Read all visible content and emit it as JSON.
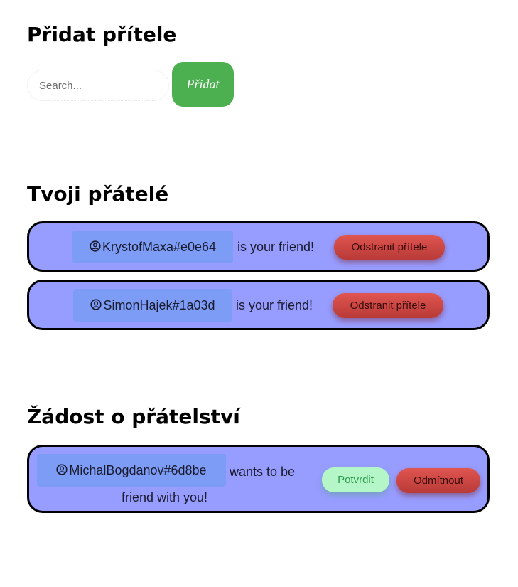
{
  "add_friend": {
    "title": "Přidat přítele",
    "search_placeholder": "Search...",
    "add_button_label": "Přidat"
  },
  "friends": {
    "title": "Tvoji přátelé",
    "items": [
      {
        "username": "KrystofMaxa#e0e64",
        "status_text": "is your friend!",
        "remove_label": "Odstranit přítele"
      },
      {
        "username": "SimonHajek#1a03d",
        "status_text": "is your friend!",
        "remove_label": "Odstranit přítele"
      }
    ]
  },
  "requests": {
    "title": "Žádost o přátelství",
    "items": [
      {
        "username": "MichalBogdanov#6d8be",
        "text_line1": "wants to be",
        "text_line2": "friend with you!",
        "confirm_label": "Potvrdit",
        "decline_label": "Odmítnout"
      }
    ]
  },
  "colors": {
    "card_background": "#979dff",
    "user_tag_background": "#7c9cf6",
    "add_button": "#4caf50",
    "remove_button": "#d9534f",
    "confirm_button": "#b4f6c8"
  },
  "icons": {
    "user": "user-circle-icon"
  }
}
